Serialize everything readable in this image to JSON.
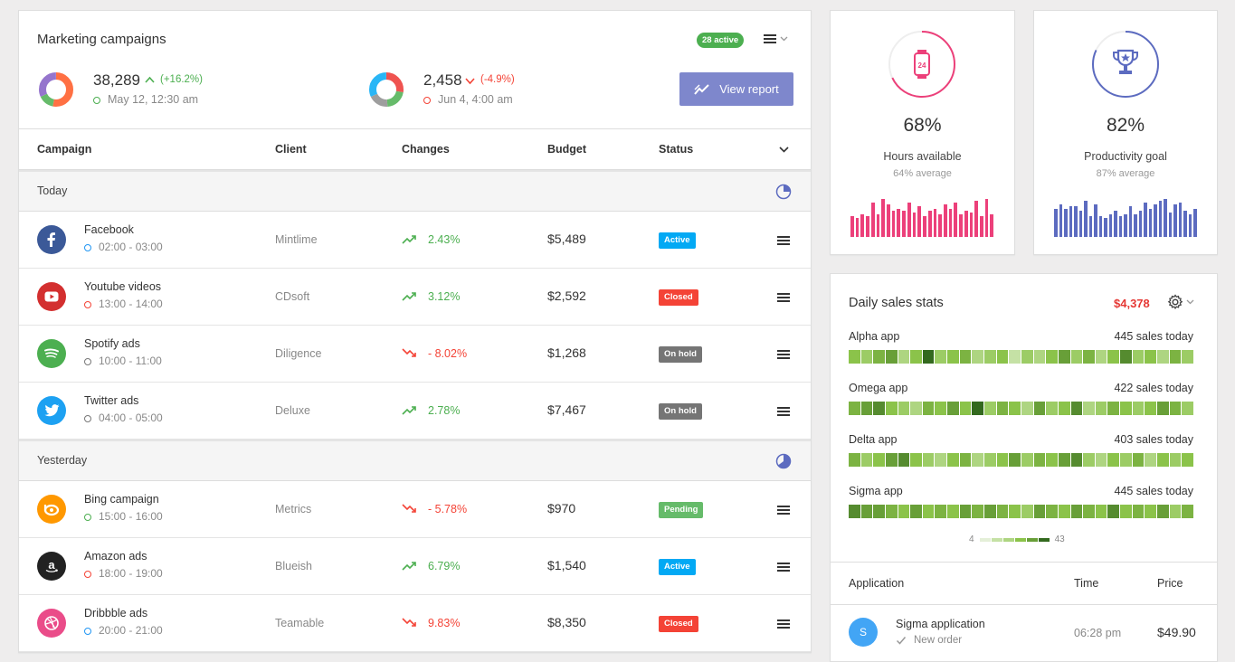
{
  "campaigns": {
    "title": "Marketing campaigns",
    "active_badge": "28 active",
    "stat1": {
      "value": "38,289",
      "change": "(+16.2%)",
      "date": "May 12, 12:30 am"
    },
    "stat2": {
      "value": "2,458",
      "change": "(-4.9%)",
      "date": "Jun 4, 4:00 am"
    },
    "view_report": "View report",
    "columns": {
      "campaign": "Campaign",
      "client": "Client",
      "changes": "Changes",
      "budget": "Budget",
      "status": "Status"
    },
    "groups": [
      {
        "label": "Today",
        "rows": [
          {
            "name": "Facebook",
            "time": "02:00 - 03:00",
            "client": "Mintlime",
            "change": "2.43%",
            "dir": "up",
            "budget": "$5,489",
            "status": "Active",
            "logo": "facebook-icon",
            "logo_color": "#3b5998",
            "dot_color": "#2196f3"
          },
          {
            "name": "Youtube videos",
            "time": "13:00 - 14:00",
            "client": "CDsoft",
            "change": "3.12%",
            "dir": "up",
            "budget": "$2,592",
            "status": "Closed",
            "logo": "youtube-icon",
            "logo_color": "#d32f2f",
            "dot_color": "#f44336"
          },
          {
            "name": "Spotify ads",
            "time": "10:00 - 11:00",
            "client": "Diligence",
            "change": "- 8.02%",
            "dir": "down",
            "budget": "$1,268",
            "status": "On hold",
            "logo": "spotify-icon",
            "logo_color": "#4caf50",
            "dot_color": "#777777"
          },
          {
            "name": "Twitter ads",
            "time": "04:00 - 05:00",
            "client": "Deluxe",
            "change": "2.78%",
            "dir": "up",
            "budget": "$7,467",
            "status": "On hold",
            "logo": "twitter-icon",
            "logo_color": "#1da1f2",
            "dot_color": "#777777"
          }
        ]
      },
      {
        "label": "Yesterday",
        "rows": [
          {
            "name": "Bing campaign",
            "time": "15:00 - 16:00",
            "client": "Metrics",
            "change": "- 5.78%",
            "dir": "down",
            "budget": "$970",
            "status": "Pending",
            "logo": "bing-icon",
            "logo_color": "#ff9800",
            "dot_color": "#4caf50"
          },
          {
            "name": "Amazon ads",
            "time": "18:00 - 19:00",
            "client": "Blueish",
            "change": "6.79%",
            "dir": "up",
            "budget": "$1,540",
            "status": "Active",
            "logo": "amazon-icon",
            "logo_color": "#222222",
            "dot_color": "#f44336"
          },
          {
            "name": "Dribbble ads",
            "time": "20:00 - 21:00",
            "client": "Teamable",
            "change": "9.83%",
            "dir": "down",
            "budget": "$8,350",
            "status": "Closed",
            "logo": "dribbble-icon",
            "logo_color": "#ea4c89",
            "dot_color": "#2196f3"
          }
        ]
      }
    ],
    "status_colors": {
      "Active": "#03a9f4",
      "Closed": "#f44336",
      "On hold": "#757575",
      "Pending": "#66bb6a"
    }
  },
  "metrics": [
    {
      "value": "68%",
      "label": "Hours available",
      "average": "64% average",
      "color": "#ec407a",
      "icon": "watch-24-icon",
      "progress": 0.68
    },
    {
      "value": "82%",
      "label": "Productivity goal",
      "average": "87% average",
      "color": "#5c6bc0",
      "icon": "trophy-icon",
      "progress": 0.82
    }
  ],
  "sales": {
    "title": "Daily sales stats",
    "total": "$4,378",
    "apps": [
      {
        "name": "Alpha app",
        "sales": "445 sales today"
      },
      {
        "name": "Omega app",
        "sales": "422 sales today"
      },
      {
        "name": "Delta app",
        "sales": "403 sales today"
      },
      {
        "name": "Sigma app",
        "sales": "445 sales today"
      }
    ],
    "legend_min": "4",
    "legend_max": "43",
    "columns": {
      "application": "Application",
      "time": "Time",
      "price": "Price"
    },
    "row": {
      "avatar": "S",
      "name": "Sigma application",
      "status": "New order",
      "time": "06:28 pm",
      "price": "$49.90"
    }
  }
}
